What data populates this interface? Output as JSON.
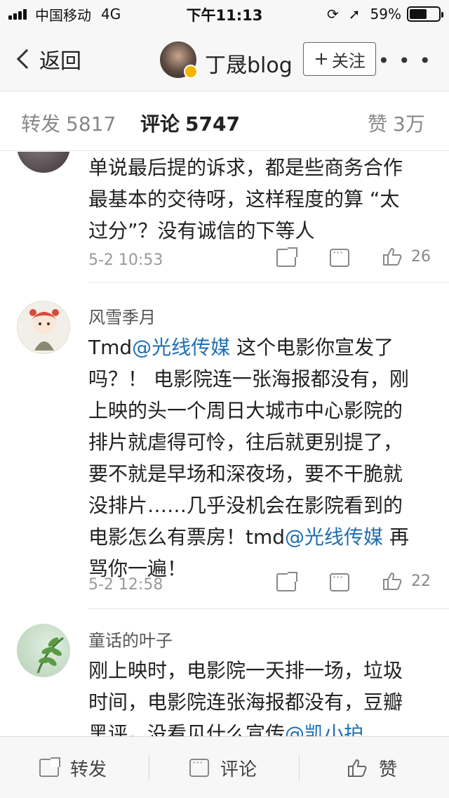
{
  "status_bar": {
    "carrier": "中国移动",
    "network": "4G",
    "time": "下午11:13",
    "battery": "59%",
    "battery_level": 0.59
  },
  "nav": {
    "back_label": "返回",
    "title": "丁晟blog",
    "follow_label": "关注"
  },
  "tabs": [
    {
      "label": "转发",
      "count": "5817"
    },
    {
      "label": "评论",
      "count": "5747"
    },
    {
      "label": "赞",
      "count": "3万"
    }
  ],
  "comments": [
    {
      "name": "",
      "lines": [
        "单说最后提的诉求，都是些商务合作",
        "最基本的交待呀，这样程度的算 “太",
        "过分”？没有诚信的下等人"
      ],
      "time": "5-2 10:53",
      "likes": "26"
    },
    {
      "name": "风雪季月",
      "line1_pre": "Tmd",
      "mention1": "@光线传媒",
      "line1_post": "  这个电影你宣发了",
      "lines_mid": [
        "吗？！ 电影院连一张海报都没有，刚",
        "上映的头一个周日大城市中心影院的",
        "排片就虐得可怜，往后就更别提了，",
        "要不就是早场和深夜场，要不干脆就",
        "没排片……几乎没机会在影院看到的"
      ],
      "line7_pre": "电影怎么有票房！tmd",
      "mention2": "@光线传媒",
      "line7_post": "  再",
      "line8": "骂你一遍！",
      "time": "5-2 12:58",
      "likes": "22"
    },
    {
      "name": "童话的叶子",
      "lines": [
        "刚上映时，电影院一天排一场，垃圾",
        "时间，电影院连张海报都没有，豆瓣"
      ],
      "line3_pre": "黑评，没看见什么宣传",
      "mention": "@凯小护"
    }
  ],
  "bottom_bar": {
    "repost_label": "转发",
    "comment_label": "评论",
    "like_label": "赞"
  }
}
